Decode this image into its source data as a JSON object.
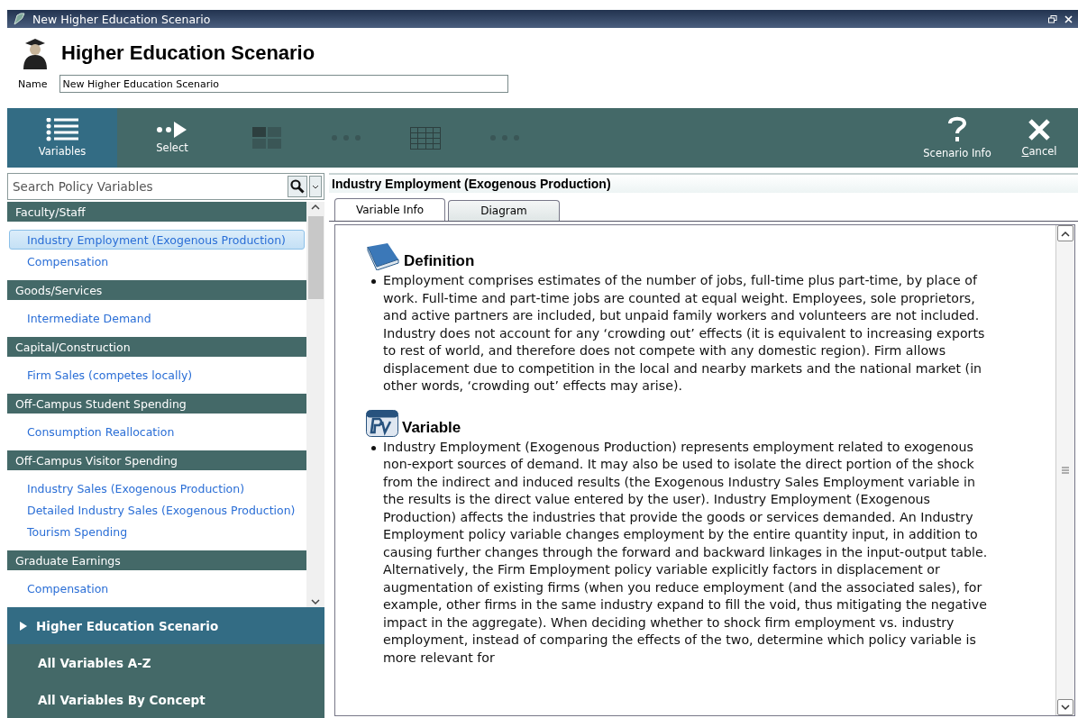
{
  "window": {
    "title": "New Higher Education Scenario"
  },
  "header": {
    "title": "Higher Education Scenario",
    "name_label": "Name",
    "name_value": "New Higher Education Scenario"
  },
  "toolbar": [
    {
      "kind": "list",
      "label": "Variables",
      "selected": true,
      "disabled": false
    },
    {
      "kind": "select",
      "label": "Select",
      "selected": false,
      "disabled": false
    },
    {
      "kind": "grid",
      "selected": false,
      "disabled": true
    },
    {
      "kind": "dots",
      "selected": false,
      "disabled": true
    },
    {
      "kind": "table",
      "selected": false,
      "disabled": true
    },
    {
      "kind": "dots",
      "selected": false,
      "disabled": true
    },
    {
      "kind": "spacer"
    },
    {
      "kind": "help",
      "label": "Scenario Info",
      "selected": false,
      "disabled": false
    },
    {
      "kind": "close",
      "label": "Cancel",
      "selected": false,
      "disabled": false
    }
  ],
  "search": {
    "placeholder": "Search Policy Variables"
  },
  "groups": [
    {
      "title": "Faculty/Staff",
      "items": [
        {
          "label": "Industry Employment (Exogenous Production)",
          "selected": true
        },
        {
          "label": "Compensation",
          "selected": false
        }
      ]
    },
    {
      "title": "Goods/Services",
      "items": [
        {
          "label": "Intermediate Demand",
          "selected": false
        }
      ]
    },
    {
      "title": "Capital/Construction",
      "items": [
        {
          "label": "Firm Sales (competes locally)",
          "selected": false
        }
      ]
    },
    {
      "title": "Off-Campus Student Spending",
      "items": [
        {
          "label": "Consumption Reallocation",
          "selected": false
        }
      ]
    },
    {
      "title": "Off-Campus Visitor Spending",
      "items": [
        {
          "label": "Industry Sales (Exogenous Production)",
          "selected": false
        },
        {
          "label": "Detailed Industry Sales (Exogenous Production)",
          "selected": false
        },
        {
          "label": "Tourism Spending",
          "selected": false
        }
      ]
    },
    {
      "title": "Graduate Earnings",
      "items": [
        {
          "label": "Compensation",
          "selected": false
        }
      ]
    }
  ],
  "nav": [
    {
      "label": "Higher Education Scenario",
      "selected": true
    },
    {
      "label": "All Variables A-Z",
      "selected": false
    },
    {
      "label": "All Variables By Concept",
      "selected": false
    }
  ],
  "detail": {
    "title": "Industry Employment (Exogenous Production)",
    "tabs": [
      {
        "label": "Variable Info",
        "selected": true
      },
      {
        "label": "Diagram",
        "selected": false
      }
    ],
    "sections": [
      {
        "kind": "book",
        "heading": "Definition",
        "text": "Employment comprises estimates of the number of jobs, full-time plus part-time, by place of work. Full-time and part-time jobs are counted at equal weight. Employees, sole proprietors, and active partners are included, but unpaid family workers and volunteers are not included. Industry does not account for any ‘crowding out’ effects (it is equivalent to increasing exports to rest of world, and therefore does not compete with any domestic region). Firm allows displacement due to competition in the local and nearby markets and the national market (in other words, ‘crowding out’ effects may arise)."
      },
      {
        "kind": "pv",
        "heading": "Variable",
        "text": "Industry Employment (Exogenous Production) represents employment related to exogenous non-export sources of demand. It may also be used to isolate the direct portion of the shock from the indirect and induced results (the Exogenous Industry Sales Employment variable in the results is the direct value entered by the user). Industry Employment (Exogenous Production) affects the industries that provide the goods or services demanded. An Industry Employment policy variable changes employment by the entire quantity input, in addition to causing further changes through the forward and backward linkages in the input-output table. Alternatively, the Firm Employment policy variable explicitly factors in displacement or augmentation of existing firms (when you reduce employment (and the associated sales), for example, other firms in the same industry expand to fill the void, thus mitigating the negative impact in the aggregate). When deciding whether to shock firm employment vs. industry employment, instead of comparing the effects of the two, determine which policy variable is more relevant for"
      }
    ]
  }
}
